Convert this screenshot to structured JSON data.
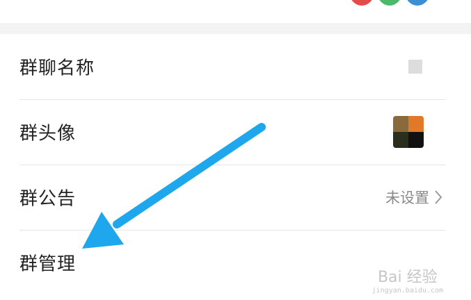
{
  "rows": [
    {
      "label": "群聊名称"
    },
    {
      "label": "群头像"
    },
    {
      "label": "群公告",
      "value": "未设置"
    },
    {
      "label": "群管理"
    }
  ],
  "icons": {
    "chevron": "chevron-right-icon",
    "arrow": "annotation-arrow-icon"
  },
  "colors": {
    "arrow": "#1ea7ec",
    "avatar_red": "#e34b4b",
    "avatar_green": "#4cb86a",
    "avatar_blue": "#3b8fd6"
  },
  "watermark": {
    "logo": "Bai 经验",
    "url": "jingyan.baidu.com"
  }
}
